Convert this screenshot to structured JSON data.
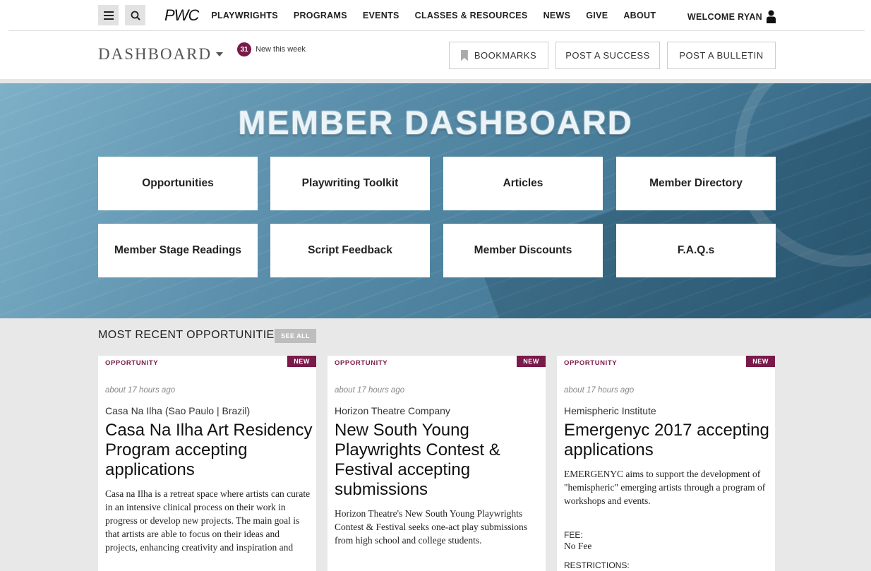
{
  "nav": {
    "logo": "PWC",
    "links": [
      "PLAYWRIGHTS",
      "PROGRAMS",
      "EVENTS",
      "CLASSES & RESOURCES",
      "NEWS",
      "GIVE",
      "ABOUT"
    ],
    "welcome": "WELCOME RYAN"
  },
  "subheader": {
    "title": "DASHBOARD",
    "new_count": "31",
    "new_label": "New this week",
    "bookmarks": "BOOKMARKS",
    "post_success": "POST A SUCCESS",
    "post_bulletin": "POST A BULLETIN"
  },
  "hero": {
    "title": "MEMBER DASHBOARD",
    "tiles": [
      "Opportunities",
      "Playwriting Toolkit",
      "Articles",
      "Member Directory",
      "Member Stage Readings",
      "Script Feedback",
      "Member Discounts",
      "F.A.Q.s"
    ]
  },
  "recent": {
    "title": "MOST RECENT OPPORTUNITIES",
    "see_all": "SEE ALL",
    "cards": [
      {
        "type": "OPPORTUNITY",
        "tag": "NEW",
        "time": "about 17 hours ago",
        "org": "Casa Na Ilha (Sao Paulo | Brazil)",
        "title": "Casa Na Ilha Art Residency Program accepting applications",
        "desc": "Casa na Ilha is a retreat space where artists can curate in an intensive clinical process on their work in progress or develop new projects. The main goal is that artists are able to focus on their ideas and projects, enhancing creativity and inspiration and"
      },
      {
        "type": "OPPORTUNITY",
        "tag": "NEW",
        "time": "about 17 hours ago",
        "org": "Horizon Theatre Company",
        "title": "New South Young Playwrights Contest & Festival accepting submissions",
        "desc": "Horizon Theatre's New South Young Playwrights Contest & Festival seeks one-act play submissions from high school and college students."
      },
      {
        "type": "OPPORTUNITY",
        "tag": "NEW",
        "time": "about 17 hours ago",
        "org": "Hemispheric Institute",
        "title": "Emergenyc 2017 accepting applications",
        "desc": "EMERGENYC aims to support the development of \"hemispheric\" emerging artists through a program of workshops and events.",
        "fee_label": "FEE:",
        "fee_value": "No Fee",
        "restrictions_label": "RESTRICTIONS:"
      }
    ]
  }
}
